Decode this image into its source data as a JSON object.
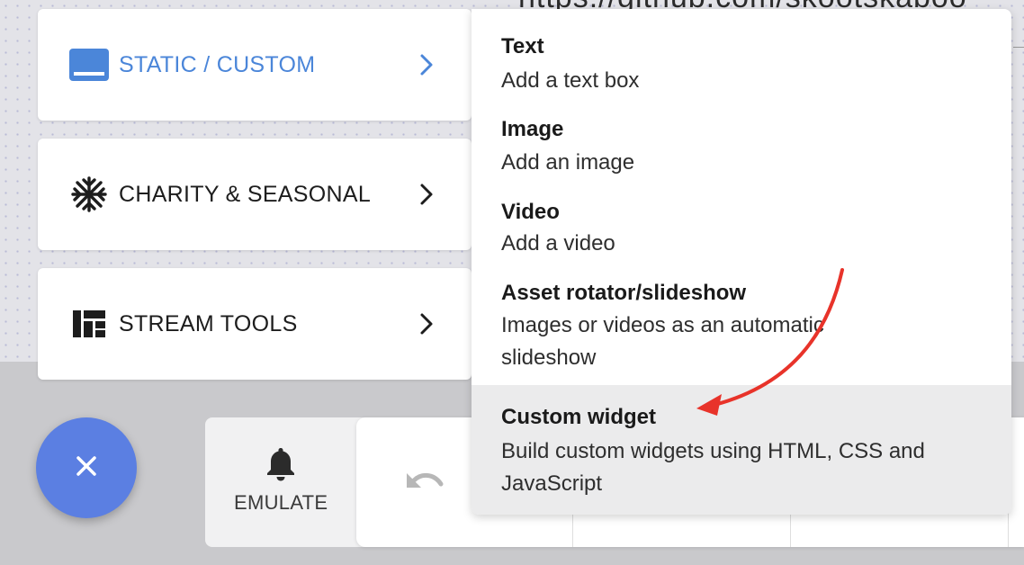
{
  "background": {
    "url_text": "https://github.com/skootskaboo"
  },
  "categories": [
    {
      "label": "STATIC / CUSTOM",
      "icon": "screen-icon",
      "active": true
    },
    {
      "label": "CHARITY & SEASONAL",
      "icon": "snowflake-icon",
      "active": false
    },
    {
      "label": "STREAM TOOLS",
      "icon": "layout-grid-icon",
      "active": false
    }
  ],
  "dropdown": {
    "items": [
      {
        "title": "Text",
        "description": "Add a text box"
      },
      {
        "title": "Image",
        "description": "Add an image"
      },
      {
        "title": "Video",
        "description": "Add a video"
      },
      {
        "title": "Asset rotator/slideshow",
        "description": "Images or videos as an automatic slideshow"
      },
      {
        "title": "Custom widget",
        "description": "Build custom widgets using HTML, CSS and JavaScript"
      }
    ],
    "highlighted_index": 4
  },
  "toolbar": {
    "emulate_label": "EMULATE",
    "bell_icon": "bell-icon",
    "undo_icon": "undo-icon"
  },
  "fab": {
    "icon": "close-icon",
    "color": "#5b7fe2"
  },
  "colors": {
    "accent_blue": "#4b86d9",
    "annotation_red": "#e8332a"
  }
}
